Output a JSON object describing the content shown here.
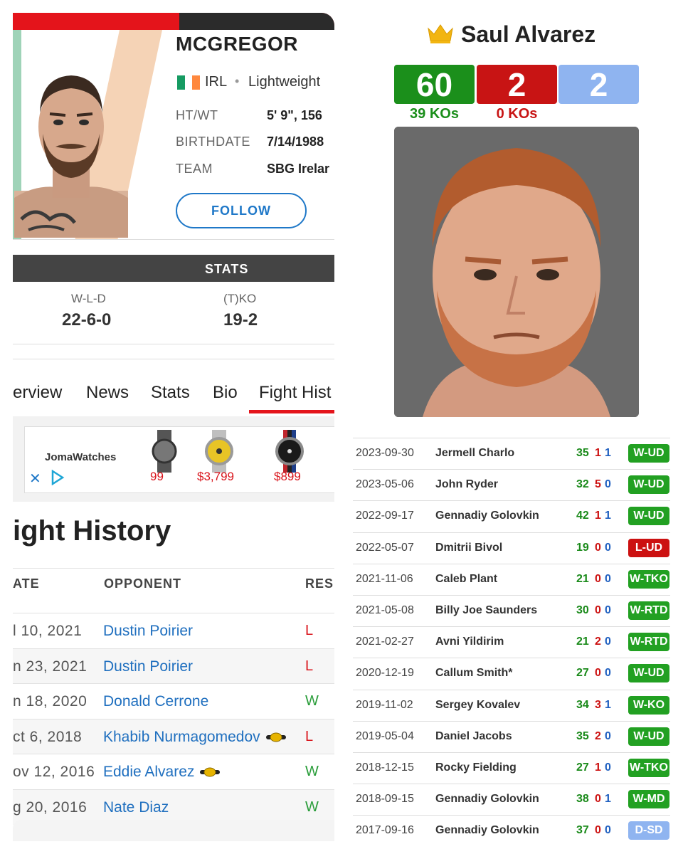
{
  "mcgregor": {
    "name": "MCGREGOR",
    "country": "IRL",
    "division": "Lightweight",
    "info": [
      {
        "label": "HT/WT",
        "value": "5' 9\", 156"
      },
      {
        "label": "BIRTHDATE",
        "value": "7/14/1988"
      },
      {
        "label": "TEAM",
        "value": "SBG Irelar"
      }
    ],
    "follow_label": "FOLLOW",
    "stats_header": "STATS",
    "stats": [
      {
        "label": "W-L-D",
        "value": "22-6-0"
      },
      {
        "label": "(T)KO",
        "value": "19-2"
      }
    ],
    "tabs": [
      "erview",
      "News",
      "Stats",
      "Bio",
      "Fight Hist"
    ],
    "ad": {
      "brand": "JomaWatches",
      "prices": [
        "99",
        "$3,799",
        "$899"
      ]
    },
    "fight_history_title": "ight History",
    "columns": [
      "ATE",
      "OPPONENT",
      "RES"
    ],
    "fights": [
      {
        "date": "l 10, 2021",
        "opponent": "Dustin Poirier",
        "result": "L",
        "belt": false
      },
      {
        "date": "n 23, 2021",
        "opponent": "Dustin Poirier",
        "result": "L",
        "belt": false
      },
      {
        "date": "n 18, 2020",
        "opponent": "Donald Cerrone",
        "result": "W",
        "belt": false
      },
      {
        "date": "ct 6, 2018",
        "opponent": "Khabib Nurmagomedov",
        "result": "L",
        "belt": true
      },
      {
        "date": "ov 12, 2016",
        "opponent": "Eddie Alvarez",
        "result": "W",
        "belt": true
      },
      {
        "date": "g 20, 2016",
        "opponent": "Nate Diaz",
        "result": "W",
        "belt": false
      }
    ],
    "colors": {
      "red": "#e4141b",
      "blue_link": "#1f6fbf",
      "win": "#2a9d3a",
      "loss": "#d9151c"
    }
  },
  "alvarez": {
    "name": "Saul Alvarez",
    "record": {
      "wins": "60",
      "losses": "2",
      "draws": "2"
    },
    "wins_kos": "39 KOs",
    "losses_kos": "0 KOs",
    "colors": {
      "win": "#1b8f1b",
      "loss": "#c81414",
      "draw": "#8fb4f0"
    },
    "bouts": [
      {
        "date": "2023-09-30",
        "opponent": "Jermell Charlo",
        "w": "35",
        "l": "1",
        "d": "1",
        "result": "W-UD",
        "color": "#22a022"
      },
      {
        "date": "2023-05-06",
        "opponent": "John Ryder",
        "w": "32",
        "l": "5",
        "d": "0",
        "result": "W-UD",
        "color": "#22a022"
      },
      {
        "date": "2022-09-17",
        "opponent": "Gennadiy Golovkin",
        "w": "42",
        "l": "1",
        "d": "1",
        "result": "W-UD",
        "color": "#22a022"
      },
      {
        "date": "2022-05-07",
        "opponent": "Dmitrii Bivol",
        "w": "19",
        "l": "0",
        "d": "0",
        "result": "L-UD",
        "color": "#cc1111"
      },
      {
        "date": "2021-11-06",
        "opponent": "Caleb Plant",
        "w": "21",
        "l": "0",
        "d": "0",
        "result": "W-TKO",
        "color": "#22a022"
      },
      {
        "date": "2021-05-08",
        "opponent": "Billy Joe Saunders",
        "w": "30",
        "l": "0",
        "d": "0",
        "result": "W-RTD",
        "color": "#22a022"
      },
      {
        "date": "2021-02-27",
        "opponent": "Avni Yildirim",
        "w": "21",
        "l": "2",
        "d": "0",
        "result": "W-RTD",
        "color": "#22a022"
      },
      {
        "date": "2020-12-19",
        "opponent": "Callum Smith*",
        "w": "27",
        "l": "0",
        "d": "0",
        "result": "W-UD",
        "color": "#22a022"
      },
      {
        "date": "2019-11-02",
        "opponent": "Sergey Kovalev",
        "w": "34",
        "l": "3",
        "d": "1",
        "result": "W-KO",
        "color": "#22a022"
      },
      {
        "date": "2019-05-04",
        "opponent": "Daniel Jacobs",
        "w": "35",
        "l": "2",
        "d": "0",
        "result": "W-UD",
        "color": "#22a022"
      },
      {
        "date": "2018-12-15",
        "opponent": "Rocky Fielding",
        "w": "27",
        "l": "1",
        "d": "0",
        "result": "W-TKO",
        "color": "#22a022"
      },
      {
        "date": "2018-09-15",
        "opponent": "Gennadiy Golovkin",
        "w": "38",
        "l": "0",
        "d": "1",
        "result": "W-MD",
        "color": "#22a022"
      },
      {
        "date": "2017-09-16",
        "opponent": "Gennadiy Golovkin",
        "w": "37",
        "l": "0",
        "d": "0",
        "result": "D-SD",
        "color": "#8fb4f0"
      }
    ]
  }
}
